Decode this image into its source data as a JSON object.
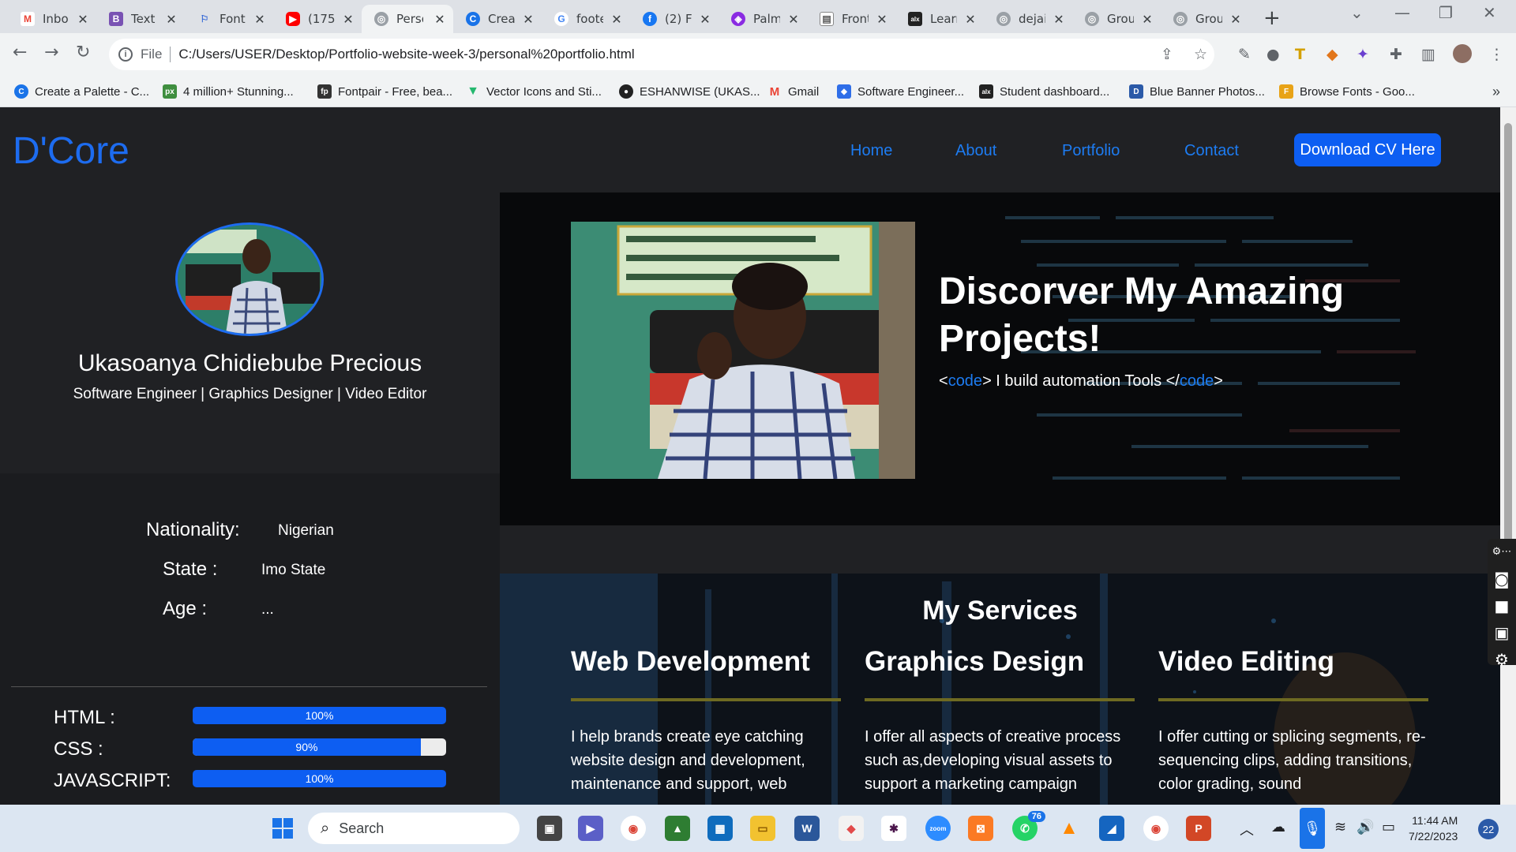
{
  "browser": {
    "tabs": [
      {
        "label": "Inbo",
        "icon": "gmail-icon",
        "color": "#EA4335"
      },
      {
        "label": "Text",
        "icon": "bootstrap-icon",
        "color": "#7952B3"
      },
      {
        "label": "Font",
        "icon": "flag-icon",
        "color": "#3367D6"
      },
      {
        "label": "(175",
        "icon": "youtube-icon",
        "color": "#FF0000"
      },
      {
        "label": "Perso",
        "icon": "globe-icon",
        "color": "#5f6368",
        "active": true
      },
      {
        "label": "Crea",
        "icon": "coolors-icon",
        "color": "#1a73e8"
      },
      {
        "label": "foote",
        "icon": "google-icon",
        "color": "#4285F4"
      },
      {
        "label": "(2) F",
        "icon": "facebook-icon",
        "color": "#1877F2"
      },
      {
        "label": "Palm",
        "icon": "palm-icon",
        "color": "#8A2BE2"
      },
      {
        "label": "Front",
        "icon": "document-icon",
        "color": "#888888"
      },
      {
        "label": "Learr",
        "icon": "alx-icon",
        "color": "#222222"
      },
      {
        "label": "dejai",
        "icon": "globe-icon",
        "color": "#5f6368"
      },
      {
        "label": "Grou",
        "icon": "globe-icon",
        "color": "#5f6368"
      },
      {
        "label": "Grou",
        "icon": "globe-icon",
        "color": "#5f6368"
      }
    ],
    "new_tab": "+",
    "address": {
      "scheme": "File",
      "url": "C:/Users/USER/Desktop/Portfolio-website-week-3/personal%20portfolio.html"
    },
    "bookmarks": [
      {
        "label": "Create a Palette - C...",
        "color": "#1a73e8"
      },
      {
        "label": "4 million+ Stunning...",
        "color": "#3f8e3f"
      },
      {
        "label": "Fontpair - Free, bea...",
        "color": "#333333"
      },
      {
        "label": "Vector Icons and Sti...",
        "color": "#25b86f"
      },
      {
        "label": "ESHANWISE (UKAS...",
        "color": "#222222"
      },
      {
        "label": "Gmail",
        "color": "#EA4335"
      },
      {
        "label": "Software Engineer...",
        "color": "#2f6ee8"
      },
      {
        "label": "Student dashboard...",
        "color": "#222222"
      },
      {
        "label": "Blue Banner Photos...",
        "color": "#2b5aa8"
      },
      {
        "label": "Browse Fonts - Goo...",
        "color": "#e8a317"
      }
    ],
    "bookmarks_more": "»"
  },
  "page": {
    "logo": "D'Core",
    "nav": [
      "Home",
      "About",
      "Portfolio",
      "Contact"
    ],
    "cv_button": "Download CV Here",
    "profile": {
      "name": "Ukasoanya Chidiebube Precious",
      "role": "Software Engineer | Graphics Designer | Video Editor"
    },
    "info": [
      {
        "key": "Nationality:",
        "value": "Nigerian"
      },
      {
        "key": "State :",
        "value": "Imo State"
      },
      {
        "key": "Age :",
        "value": "..."
      }
    ],
    "skills": [
      {
        "label": "HTML :",
        "value": 100,
        "text": "100%"
      },
      {
        "label": "CSS :",
        "value": 90,
        "text": "90%"
      },
      {
        "label": "JAVASCRIPT:",
        "value": 100,
        "text": "100%"
      }
    ],
    "hero": {
      "title": "Discorver My Amazing Projects!",
      "sub_open": "<",
      "sub_tag": "code",
      "sub_mid": "> I build automation Tools </",
      "sub_tag2": "code",
      "sub_close": ">"
    },
    "services": {
      "title": "My Services",
      "items": [
        {
          "title": "Web Development",
          "text": "I help brands create eye catching website design and development, maintenance and support, web"
        },
        {
          "title": "Graphics Design",
          "text": "I offer all aspects of creative process such as,developing visual assets to support a marketing campaign"
        },
        {
          "title": "Video Editing",
          "text": "I offer cutting or splicing segments, re-sequencing clips, adding transitions, color grading, sound"
        }
      ]
    }
  },
  "taskbar": {
    "search_placeholder": "Search",
    "whatsapp_badge": "76",
    "time": "11:44 AM",
    "date": "7/22/2023",
    "notifications": "22"
  },
  "colors": {
    "accent": "#1D6CF0",
    "button": "#0D5EF2",
    "service_line": "#6E6A22"
  }
}
